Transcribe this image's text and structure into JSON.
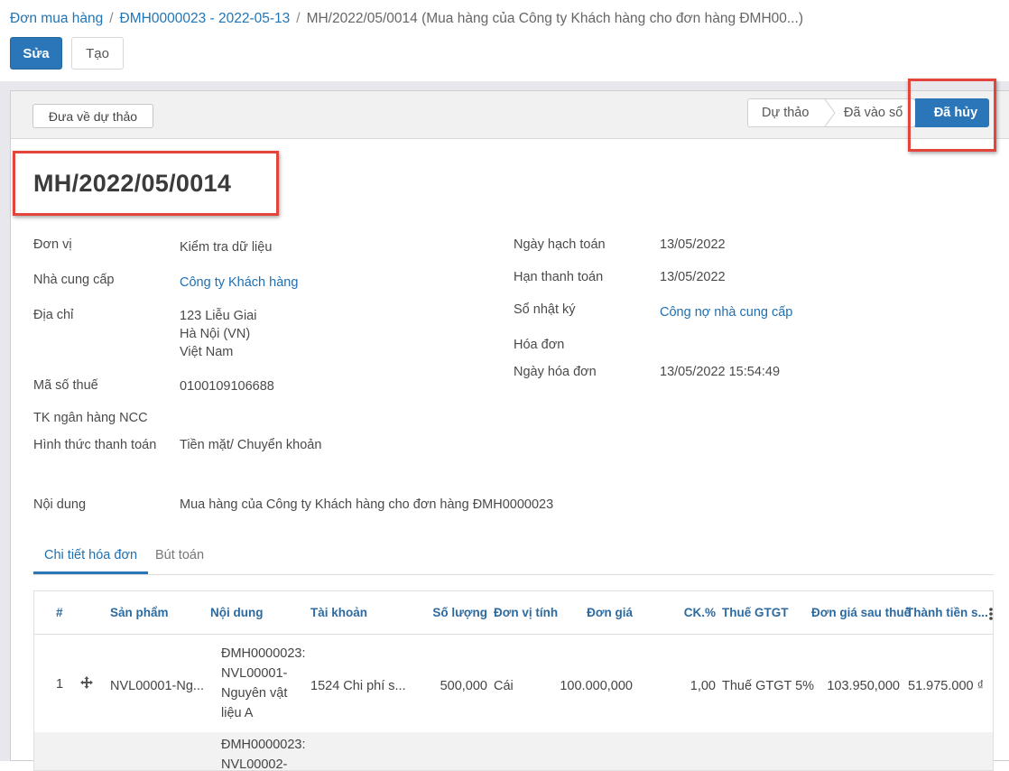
{
  "breadcrumb": {
    "root": "Đơn mua hàng",
    "parent": "ĐMH0000023 - 2022-05-13",
    "current": "MH/2022/05/0014 (Mua hàng của Công ty Khách hàng cho đơn hàng ĐMH00...)",
    "separator": "/"
  },
  "toolbar": {
    "edit_label": "Sửa",
    "create_label": "Tạo"
  },
  "statusbar": {
    "reset_draft_label": "Đưa về dự thảo",
    "steps": [
      "Dự thảo",
      "Đã vào sổ"
    ],
    "active_step": "Đã hủy",
    "active_color": "#2b76b9"
  },
  "record": {
    "title": "MH/2022/05/0014",
    "left_fields": {
      "unit_label": "Đơn vị",
      "unit_value": "Kiểm tra dữ liệu",
      "vendor_label": "Nhà cung cấp",
      "vendor_value": "Công ty Khách hàng",
      "address_label": "Địa chỉ",
      "address_line1": "123 Liễu Giai",
      "address_line2": "Hà Nội (VN)",
      "address_line3": "Việt Nam",
      "tax_label": "Mã số thuế",
      "tax_value": "0100109106688",
      "bank_label": "TK ngân hàng NCC",
      "payment_label": "Hình thức thanh toán",
      "payment_value": "Tiền mặt/ Chuyển khoản"
    },
    "right_fields": {
      "acc_date_label": "Ngày hạch toán",
      "acc_date_value": "13/05/2022",
      "due_label": "Hạn thanh toán",
      "due_value": "13/05/2022",
      "journal_label": "Sổ nhật ký",
      "journal_value": "Công nợ nhà cung cấp",
      "invoice_label": "Hóa đơn",
      "invoice_date_label": "Ngày hóa đơn",
      "invoice_date_value": "13/05/2022 15:54:49"
    },
    "content_label": "Nội dung",
    "content_value": "Mua hàng của Công ty Khách hàng cho đơn hàng ĐMH0000023"
  },
  "tabs": {
    "active": "Chi tiết hóa đơn",
    "other": "Bút toán"
  },
  "table": {
    "headers": {
      "num": "#",
      "product": "Sản phẩm",
      "desc": "Nội dung",
      "account": "Tài khoản",
      "qty": "Số lượng",
      "uom": "Đơn vị tính",
      "price": "Đơn giá",
      "discount": "CK.%",
      "vat": "Thuế GTGT",
      "price_after_tax": "Đơn giá sau thuế",
      "subtotal": "Thành tiền s..."
    },
    "rows": [
      {
        "num": "1",
        "product": "NVL00001-Ng...",
        "desc_lines": [
          "ĐMH0000023:",
          "NVL00001-",
          "Nguyên vật",
          "liệu A"
        ],
        "account": "1524 Chi phí s...",
        "qty": "500,000",
        "uom": "Cái",
        "price": "100.000,000",
        "discount": "1,00",
        "vat": "Thuế GTGT 5%",
        "price_after_tax": "103.950,000",
        "subtotal": "51.975.000 ₫"
      },
      {
        "desc_lines": [
          "ĐMH0000023:",
          "NVL00002-"
        ]
      }
    ]
  }
}
